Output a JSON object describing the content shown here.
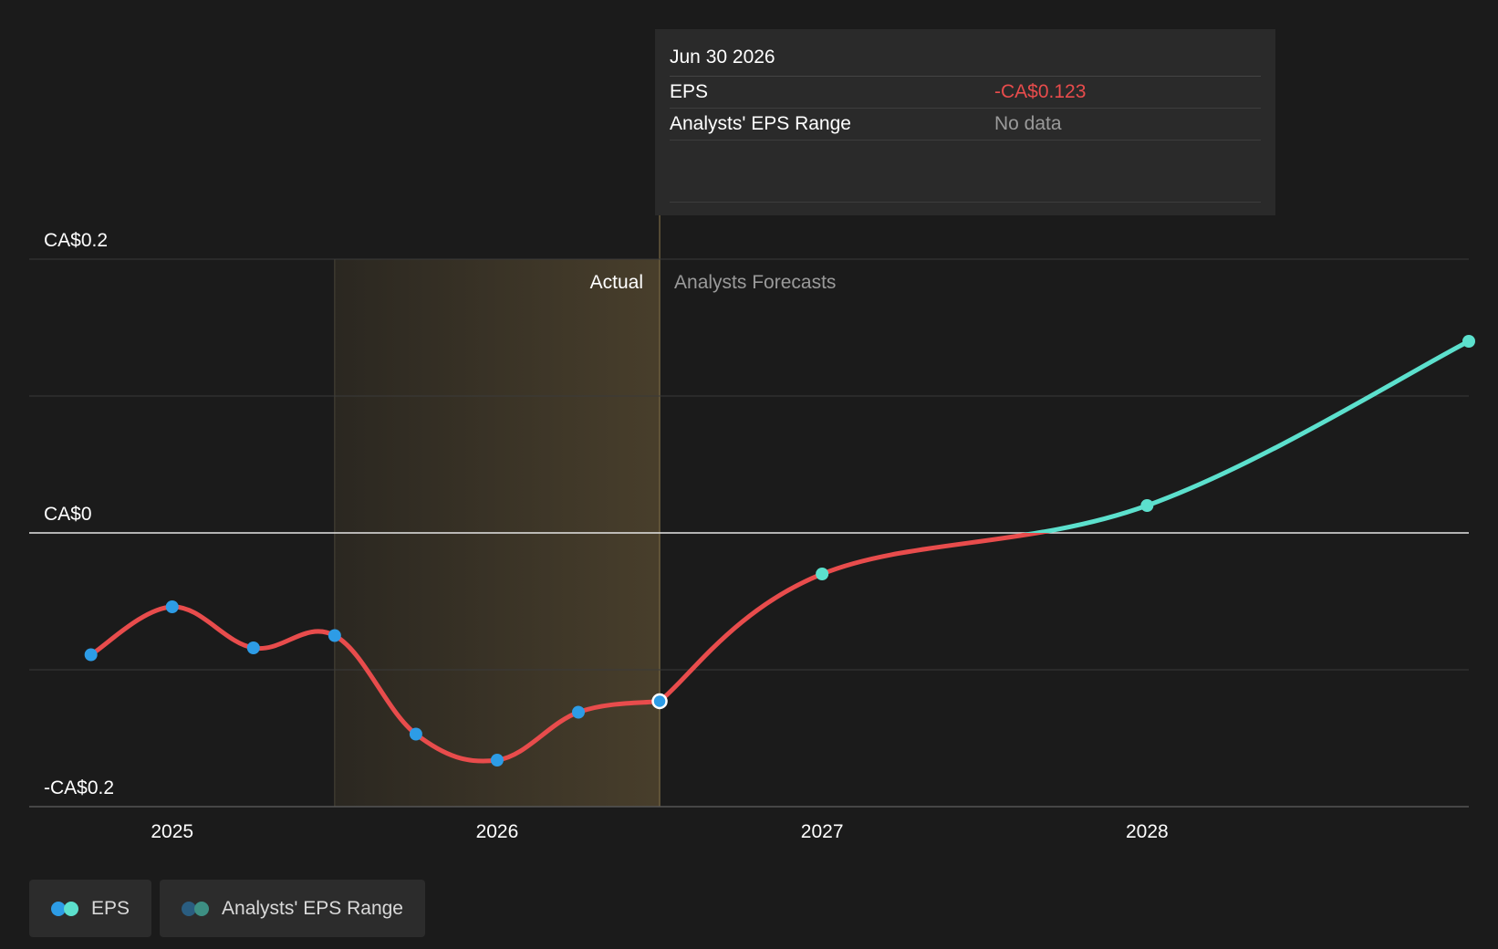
{
  "chart_data": {
    "type": "line",
    "y_axis": {
      "ticks": [
        {
          "value": 0.2,
          "label": "CA$0.2"
        },
        {
          "value": 0,
          "label": "CA$0"
        },
        {
          "value": -0.2,
          "label": "-CA$0.2"
        }
      ],
      "ylim": [
        -0.2,
        0.2
      ]
    },
    "x_axis": {
      "ticks": [
        {
          "value": 2025.0,
          "label": "2025"
        },
        {
          "value": 2026.0,
          "label": "2026"
        },
        {
          "value": 2027.0,
          "label": "2027"
        },
        {
          "value": 2028.0,
          "label": "2028"
        }
      ],
      "xlim": [
        2024.56,
        2028.99
      ]
    },
    "grid": true,
    "regions": {
      "actual_label": "Actual",
      "forecast_label": "Analysts Forecasts",
      "highlight_start": 2025.5,
      "divider": 2026.5
    },
    "series": [
      {
        "name": "EPS",
        "segment": "actual",
        "color": "#e84c4c",
        "marker_color": "#2d9ce6",
        "points": [
          {
            "x": 2024.75,
            "y": -0.089
          },
          {
            "x": 2025.0,
            "y": -0.054
          },
          {
            "x": 2025.25,
            "y": -0.084
          },
          {
            "x": 2025.5,
            "y": -0.075
          },
          {
            "x": 2025.75,
            "y": -0.147
          },
          {
            "x": 2026.0,
            "y": -0.166
          },
          {
            "x": 2026.25,
            "y": -0.131
          },
          {
            "x": 2026.5,
            "y": -0.123
          }
        ]
      },
      {
        "name": "EPS",
        "segment": "forecast",
        "color": "#e84c4c",
        "forecast_color": "#5ce0cd",
        "points": [
          {
            "x": 2026.5,
            "y": -0.123
          },
          {
            "x": 2027.0,
            "y": -0.03
          },
          {
            "x": 2028.0,
            "y": 0.02
          },
          {
            "x": 2028.99,
            "y": 0.14
          }
        ]
      }
    ],
    "highlighted_point": {
      "x": 2026.5,
      "y": -0.123
    }
  },
  "tooltip": {
    "date": "Jun 30 2026",
    "rows": [
      {
        "label": "EPS",
        "value": "-CA$0.123"
      },
      {
        "label": "Analysts' EPS Range",
        "value": "No data"
      }
    ]
  },
  "legend": {
    "items": [
      {
        "label": "EPS",
        "colors": [
          "#2d9ce6",
          "#5ce0cd"
        ]
      },
      {
        "label": "Analysts' EPS Range",
        "colors": [
          "#2a5d80",
          "#3d8f83"
        ]
      }
    ]
  }
}
